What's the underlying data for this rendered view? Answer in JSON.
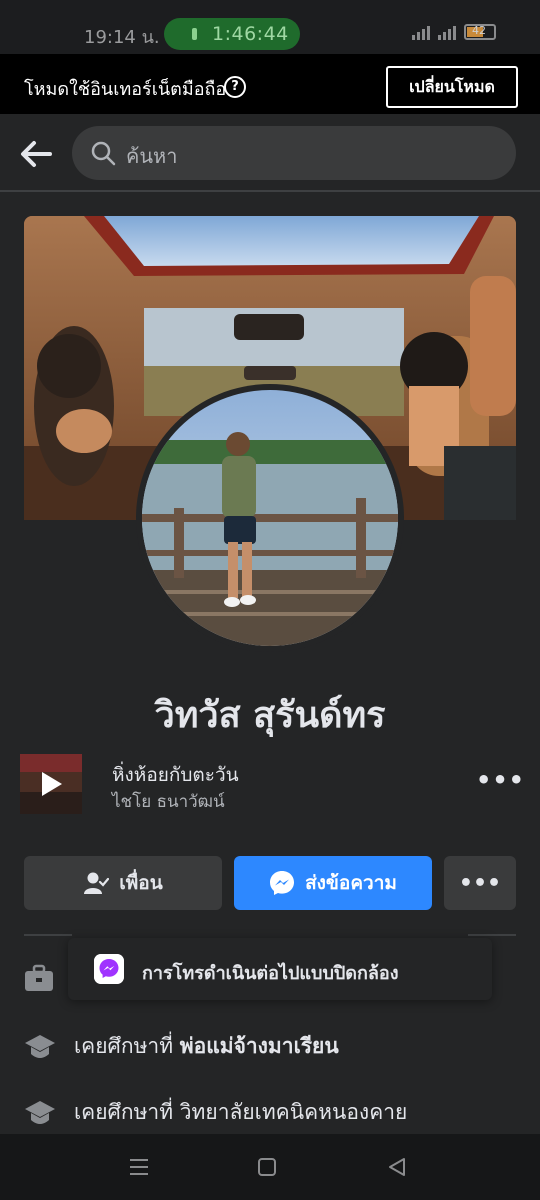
{
  "status_bar": {
    "time": "19:14 น.",
    "call_timer": "1:46:44",
    "battery": "42"
  },
  "mode_banner": {
    "text": "โหมดใช้อินเทอร์เน็ตมือถือ",
    "help": "?",
    "switch_label": "เปลี่ยนโหมด"
  },
  "search": {
    "placeholder": "ค้นหา"
  },
  "profile": {
    "name": "วิทวัส สุรันด์ทร"
  },
  "music": {
    "title": "หิ่งห้อยกับตะวัน",
    "artist": "ไชโย ธนาวัฒน์"
  },
  "actions": {
    "friend_label": "เพื่อน",
    "message_label": "ส่งข้อความ",
    "more_label": "•••"
  },
  "toast": {
    "text": "การโทรดำเนินต่อไปแบบปิดกล้อง"
  },
  "info": {
    "studied_prefix": "เคยศึกษาที่",
    "school1": "พ่อแม่จ้างมาเรียน",
    "school2": "วิทยาลัยเทคนิคหนองคาย"
  },
  "colors": {
    "accent": "#2d88ff",
    "background": "#242526",
    "call_pill": "#1f6b2c"
  },
  "icons": [
    "back-arrow-icon",
    "search-icon",
    "help-icon",
    "play-icon",
    "add-friend-icon",
    "messenger-icon",
    "briefcase-icon",
    "graduation-cap-icon"
  ]
}
